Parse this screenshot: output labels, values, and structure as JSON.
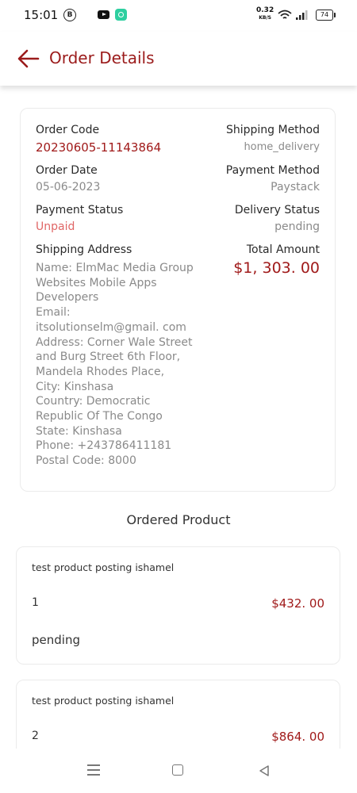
{
  "status_bar": {
    "time": "15:01",
    "b_badge": "B",
    "net_speed_value": "0.32",
    "net_speed_unit": "KB/S",
    "battery": "74",
    "icons": [
      "b-circle-icon",
      "youtube-icon",
      "message-app-icon",
      "wifi-icon",
      "signal-icon",
      "battery-icon"
    ]
  },
  "header": {
    "title": "Order Details",
    "back_icon": "back-arrow-icon",
    "accent": "#9b1b1b"
  },
  "order": {
    "code_label": "Order Code",
    "code_value": "20230605-11143864",
    "shipping_method_label": "Shipping Method",
    "shipping_method_value": "home_delivery",
    "date_label": "Order Date",
    "date_value": "05-06-2023",
    "payment_method_label": "Payment Method",
    "payment_method_value": "Paystack",
    "payment_status_label": "Payment Status",
    "payment_status_value": "Unpaid",
    "delivery_status_label": "Delivery Status",
    "delivery_status_value": "pending",
    "shipping_address_label": "Shipping Address",
    "total_label": "Total Amount",
    "total_value": "$1, 303. 00",
    "address_lines": [
      "Name: ElmMac Media Group",
      "Websites Mobile Apps",
      "Developers",
      "Email:",
      "itsolutionselm@gmail. com",
      "Address: Corner Wale Street",
      "and Burg Street 6th Floor,",
      "Mandela Rhodes Place,",
      "City: Kinshasa",
      "Country: Democratic",
      "Republic Of The Congo",
      "State: Kinshasa",
      "Phone: +243786411181",
      "Postal Code: 8000"
    ]
  },
  "ordered_product_title": "Ordered Product",
  "products": [
    {
      "name": "test product posting ishamel",
      "qty": "1",
      "price": "$432. 00",
      "status": "pending"
    },
    {
      "name": "test product posting ishamel",
      "qty": "2",
      "price": "$864. 00"
    }
  ],
  "nav_bar": {
    "icons": [
      "menu-icon",
      "home-icon",
      "back-icon"
    ]
  }
}
